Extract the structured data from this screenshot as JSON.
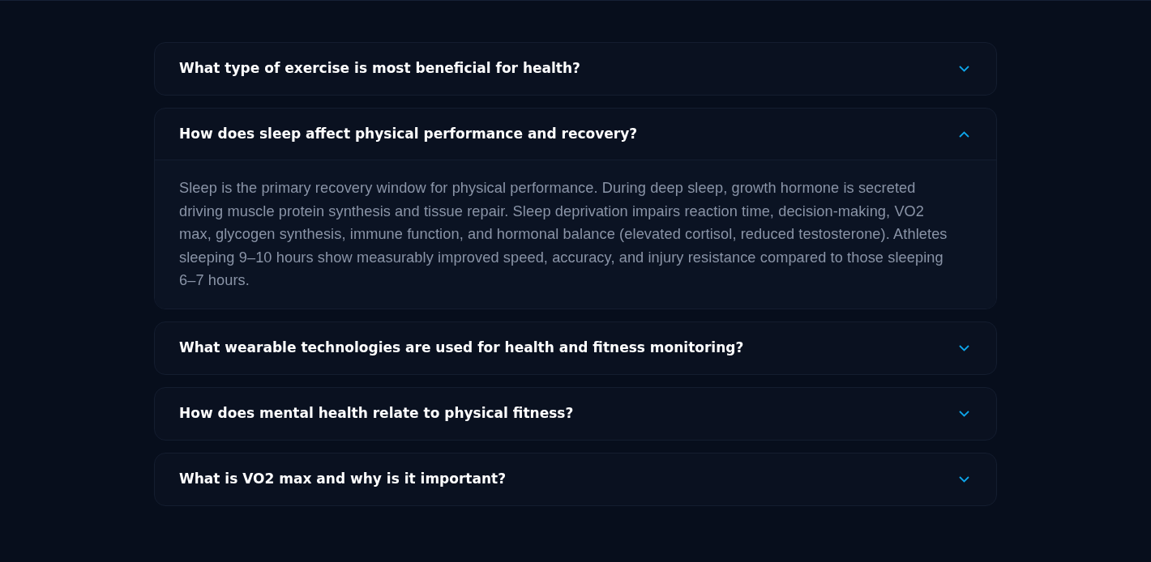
{
  "faq": [
    {
      "question": "What type of exercise is most beneficial for health?",
      "expanded": false
    },
    {
      "question": "How does sleep affect physical performance and recovery?",
      "expanded": true,
      "answer": "Sleep is the primary recovery window for physical performance. During deep sleep, growth hormone is secreted driving muscle protein synthesis and tissue repair. Sleep deprivation impairs reaction time, decision-making, VO2 max, glycogen synthesis, immune function, and hormonal balance (elevated cortisol, reduced testosterone). Athletes sleeping 9–10 hours show measurably improved speed, accuracy, and injury resistance compared to those sleeping 6–7 hours."
    },
    {
      "question": "What wearable technologies are used for health and fitness monitoring?",
      "expanded": false
    },
    {
      "question": "How does mental health relate to physical fitness?",
      "expanded": false
    },
    {
      "question": "What is VO2 max and why is it important?",
      "expanded": false
    }
  ]
}
